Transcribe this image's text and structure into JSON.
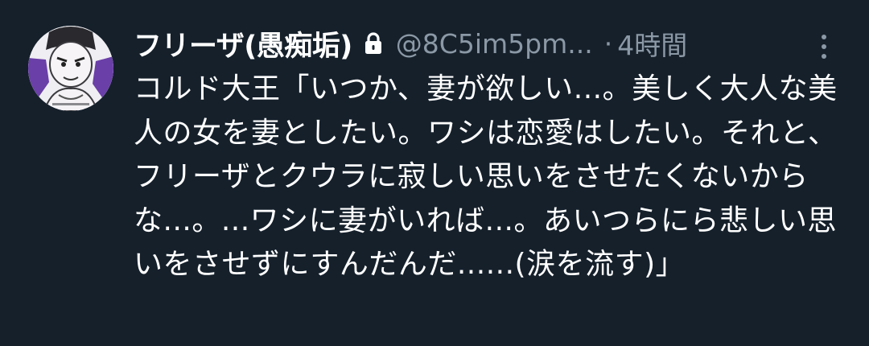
{
  "tweet": {
    "display_name": "フリーザ(愚痴垢)",
    "handle": "@8C5im5pm...",
    "separator": "·",
    "time": "4時間",
    "text": "コルド大王「いつか、妻が欲しい...。美しく大人な美人の女を妻としたい。ワシは恋愛はしたい。それと、フリーザとクウラに寂しい思いをさせたくないからな...。...ワシに妻がいれば...。あいつらにら悲しい思いをさせずにすんだんだ......(涙を流す)」"
  },
  "icons": {
    "lock": "lock-icon",
    "more": "more-vertical-icon",
    "avatar": "avatar-image"
  },
  "colors": {
    "background": "#15202b",
    "primary_text": "#ffffff",
    "secondary_text": "#8b98a5"
  }
}
